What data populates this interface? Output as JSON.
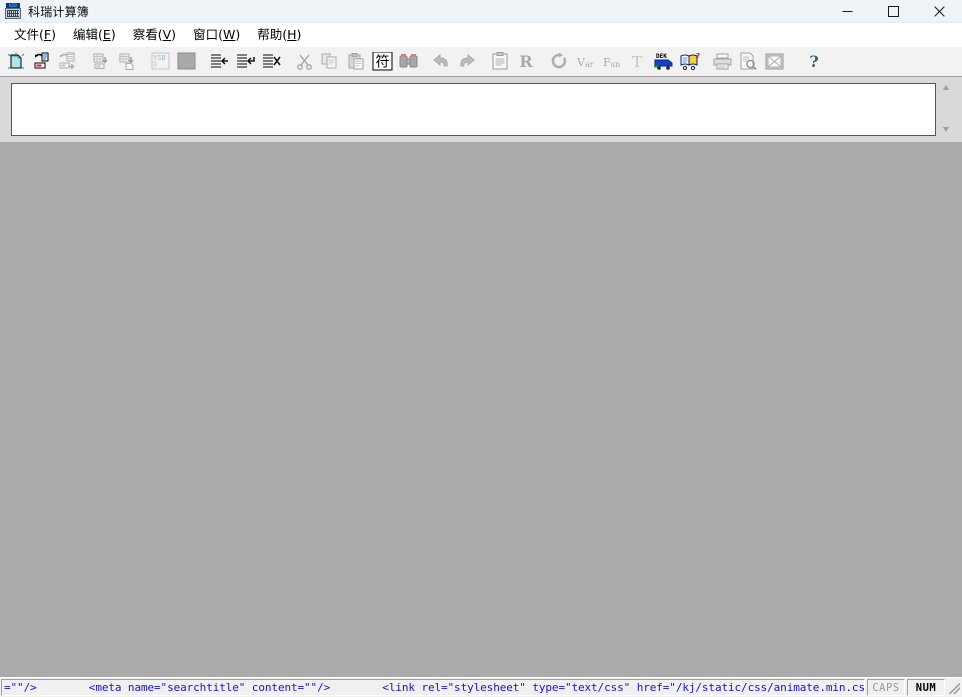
{
  "window": {
    "title": "科瑞计算簿",
    "icon": "calculator-keyboard-icon",
    "controls": {
      "minimize_label": "—",
      "maximize_label": "□",
      "close_label": "✕"
    }
  },
  "menubar": {
    "items": [
      {
        "text": "文件",
        "accel": "F"
      },
      {
        "text": "编辑",
        "accel": "E"
      },
      {
        "text": "察看",
        "accel": "V"
      },
      {
        "text": "窗口",
        "accel": "W"
      },
      {
        "text": "帮助",
        "accel": "H"
      }
    ]
  },
  "toolbar": {
    "groups": [
      {
        "buttons": [
          {
            "name": "new-document-button",
            "icon": "new-page-icon",
            "enabled": true
          },
          {
            "name": "open-document-button",
            "icon": "open-folder-page-icon",
            "enabled": true
          },
          {
            "name": "save-document-button",
            "icon": "save-page-plus-icon",
            "enabled": false
          }
        ]
      },
      {
        "buttons": [
          {
            "name": "import-button",
            "icon": "grid-import-icon",
            "enabled": false
          },
          {
            "name": "export-button",
            "icon": "grid-export-page-icon",
            "enabled": false
          }
        ]
      },
      {
        "buttons": [
          {
            "name": "ysb-button",
            "icon": "ysb-label-icon",
            "label": "YSB",
            "enabled": false
          },
          {
            "name": "blank-panel-button",
            "icon": "filled-block-icon",
            "enabled": false
          }
        ]
      },
      {
        "buttons": [
          {
            "name": "insert-row-before-button",
            "icon": "lines-arrow-left-icon",
            "enabled": true
          },
          {
            "name": "insert-row-after-button",
            "icon": "lines-arrow-return-icon",
            "enabled": true
          },
          {
            "name": "delete-row-button",
            "icon": "lines-delete-x-icon",
            "enabled": true
          }
        ]
      },
      {
        "buttons": [
          {
            "name": "cut-button",
            "icon": "scissors-icon",
            "enabled": false
          },
          {
            "name": "copy-button",
            "icon": "copy-pages-icon",
            "enabled": false
          },
          {
            "name": "paste-button",
            "icon": "clipboard-paste-icon",
            "enabled": false
          },
          {
            "name": "insert-symbol-button",
            "icon": "chinese-char-fu-icon",
            "label": "符",
            "enabled": true
          },
          {
            "name": "find-button",
            "icon": "binoculars-icon",
            "enabled": false
          }
        ]
      },
      {
        "buttons": [
          {
            "name": "undo-button",
            "icon": "undo-arrow-icon",
            "enabled": false
          },
          {
            "name": "redo-button",
            "icon": "redo-arrow-icon",
            "enabled": false
          }
        ]
      },
      {
        "buttons": [
          {
            "name": "properties-button",
            "icon": "clipboard-properties-icon",
            "enabled": false
          },
          {
            "name": "run-r-button",
            "icon": "letter-r-icon",
            "label": "R",
            "enabled": false
          }
        ]
      },
      {
        "buttons": [
          {
            "name": "refresh-button",
            "icon": "circular-arrow-icon",
            "enabled": false
          },
          {
            "name": "variables-button",
            "icon": "var-label-icon",
            "label": "Var",
            "enabled": false
          },
          {
            "name": "functions-button",
            "icon": "fun-label-icon",
            "label": "Fun",
            "enabled": false
          },
          {
            "name": "text-tool-button",
            "icon": "letter-t-icon",
            "label": "T",
            "enabled": false
          },
          {
            "name": "dek-truck-button",
            "icon": "blue-truck-dek-icon",
            "label": "DEK",
            "enabled": true
          },
          {
            "name": "help-book-button",
            "icon": "open-book-question-icon",
            "enabled": true
          }
        ]
      },
      {
        "buttons": [
          {
            "name": "print-button",
            "icon": "printer-icon",
            "enabled": false
          },
          {
            "name": "print-preview-button",
            "icon": "page-magnifier-icon",
            "enabled": false
          },
          {
            "name": "image-button",
            "icon": "picture-x-icon",
            "enabled": false
          }
        ]
      },
      {
        "buttons": [
          {
            "name": "help-button",
            "icon": "question-mark-icon",
            "label": "?",
            "enabled": true
          }
        ]
      }
    ]
  },
  "document": {
    "content": "",
    "scrollbar": {
      "up_arrow": "scroll-up-arrow",
      "down_arrow": "scroll-down-arrow"
    }
  },
  "statusbar": {
    "message": "=\"\"/>        <meta name=\"searchtitle\" content=\"\"/>        <link rel=\"stylesheet\" type=\"text/css\" href=\"/kj/static/css/animate.min.css\"/>        <link rel=\"",
    "indicators": [
      {
        "label": "CAPS",
        "active": false
      },
      {
        "label": "NUM",
        "active": true
      }
    ]
  },
  "colors": {
    "titlebar_bg": "#eef3f7",
    "menubar_bg": "#ffffff",
    "toolbar_bg": "#f2f2f2",
    "client_bg": "#ababab",
    "document_bg": "#ffffff",
    "status_text": "#1414d2"
  }
}
